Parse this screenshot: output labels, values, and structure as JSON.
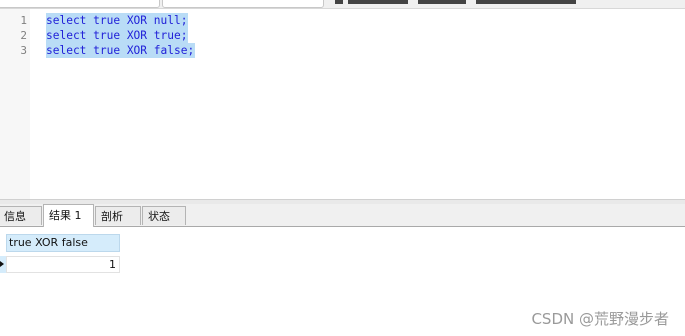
{
  "editor": {
    "line_numbers": [
      "1",
      "2",
      "3"
    ],
    "lines": [
      "select true XOR null;",
      "select true XOR true;",
      "select true XOR false;"
    ]
  },
  "result_tabs": [
    {
      "label": "信息",
      "active": false
    },
    {
      "label": "结果 1",
      "active": true
    },
    {
      "label": "剖析",
      "active": false
    },
    {
      "label": "状态",
      "active": false
    }
  ],
  "result_grid": {
    "columns": [
      "true XOR false"
    ],
    "rows": [
      [
        "1"
      ]
    ]
  },
  "watermark": "CSDN @荒野漫步者"
}
